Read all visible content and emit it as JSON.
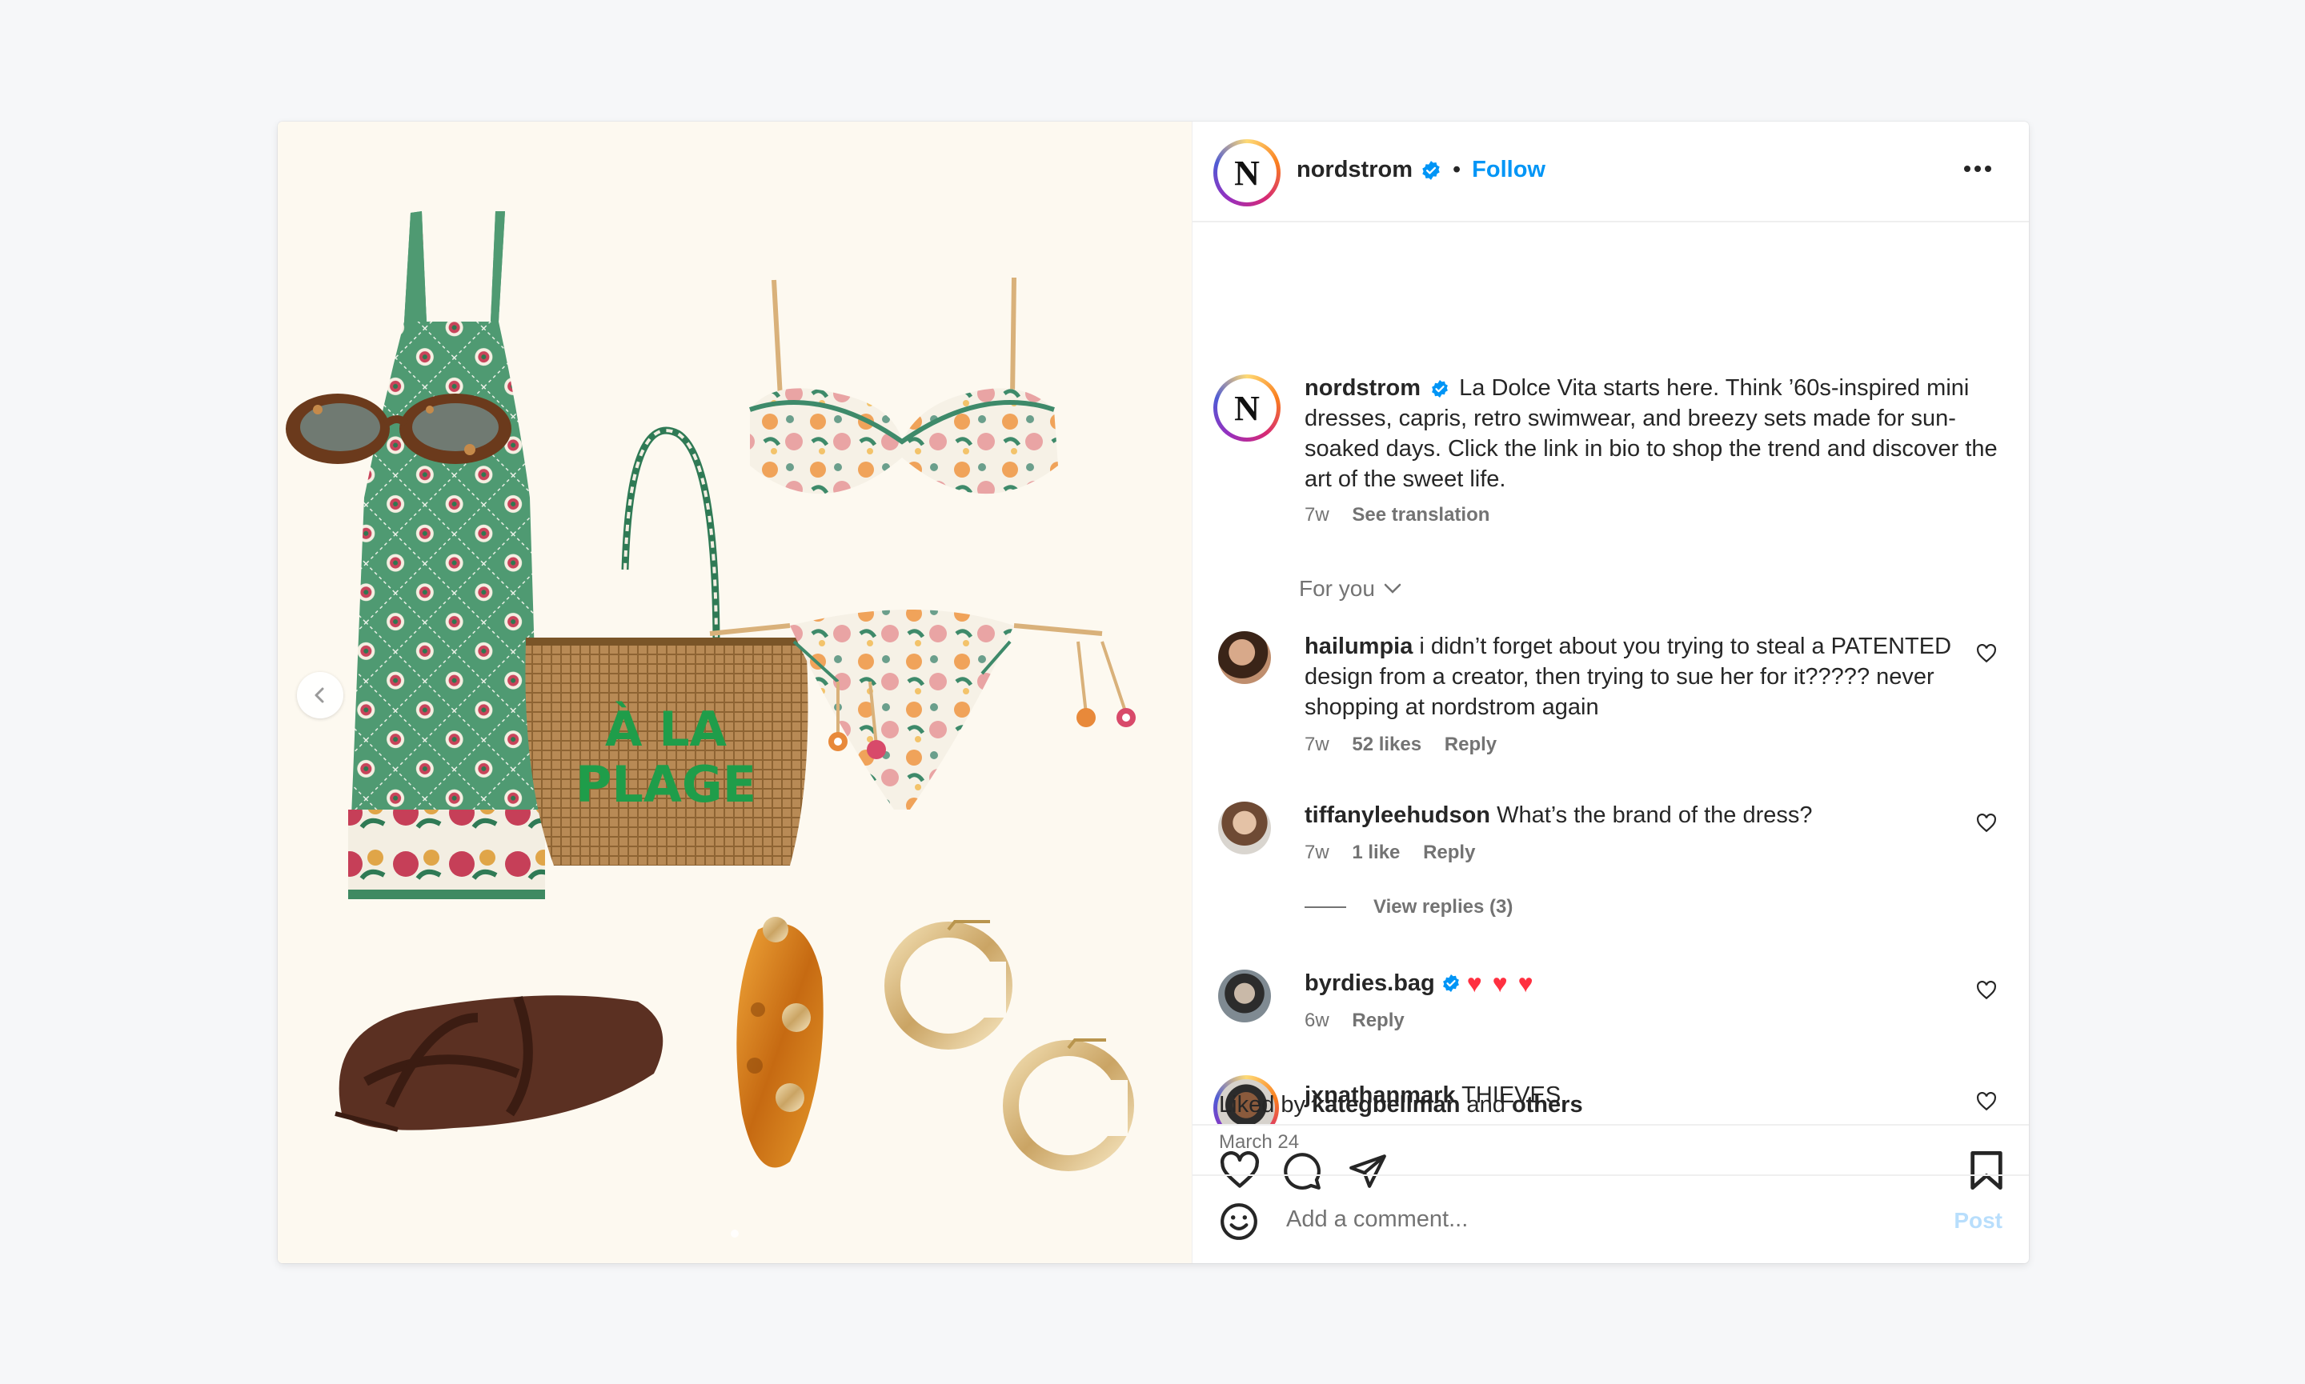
{
  "post": {
    "author": {
      "username": "nordstrom",
      "avatar_letter": "N",
      "separator": "•",
      "follow_label": "Follow"
    },
    "caption": {
      "username": "nordstrom",
      "text": "La Dolce Vita starts here. Think ’60s-inspired mini dresses, capris, retro swimwear, and breezy sets made for sun-soaked days. Click the link in bio to shop the trend and discover the art of the sweet life.",
      "time": "7w",
      "see_translation": "See translation"
    },
    "sort_label": "For you",
    "comments": [
      {
        "username": "hailumpia",
        "text": "i didn’t forget about you trying to steal a PATENTED design from a creator, then trying to sue her for it????? never shopping at nordstrom again",
        "time": "7w",
        "likes": "52 likes",
        "reply": "Reply"
      },
      {
        "username": "tiffanyleehudson",
        "text": "What’s the brand of the dress?",
        "time": "7w",
        "likes": "1 like",
        "reply": "Reply",
        "view_replies": "View replies (3)"
      },
      {
        "username": "byrdies.bag",
        "text": "",
        "hearts": "♥ ♥ ♥",
        "time": "6w",
        "reply": "Reply"
      },
      {
        "username": "jxnathanmark",
        "text": "THIEVES"
      }
    ],
    "liked_by": {
      "prefix": "Liked by",
      "user": "kategbellman",
      "conj": "and",
      "others": "others"
    },
    "date": "March 24",
    "composer": {
      "placeholder": "Add a comment...",
      "post_label": "Post"
    },
    "media": {
      "bag_text_line1": "À LA",
      "bag_text_line2": "PLAGE"
    }
  },
  "colors": {
    "link_blue": "#0095f6",
    "post_disabled": "#b8defc",
    "heart_red": "#ff3040",
    "media_bg": "#fdf9f0"
  },
  "icons": [
    "chevron-left-icon",
    "verified-badge-icon",
    "more-options-icon",
    "heart-icon",
    "comment-icon",
    "share-icon",
    "bookmark-icon",
    "emoji-icon",
    "chevron-down-icon"
  ]
}
